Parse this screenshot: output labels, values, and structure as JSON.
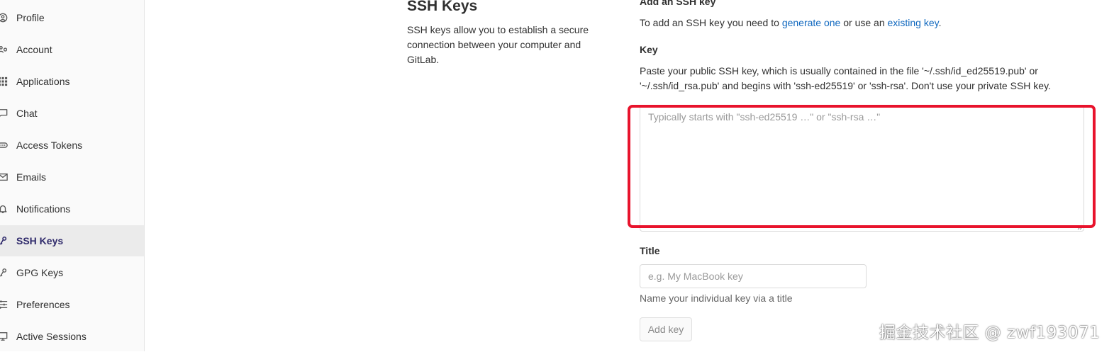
{
  "sidebar": {
    "items": [
      {
        "label": "Profile",
        "icon": "profile-icon"
      },
      {
        "label": "Account",
        "icon": "account-icon"
      },
      {
        "label": "Applications",
        "icon": "applications-icon"
      },
      {
        "label": "Chat",
        "icon": "chat-icon"
      },
      {
        "label": "Access Tokens",
        "icon": "token-icon"
      },
      {
        "label": "Emails",
        "icon": "mail-icon"
      },
      {
        "label": "Notifications",
        "icon": "bell-icon"
      },
      {
        "label": "SSH Keys",
        "icon": "key-icon",
        "active": true
      },
      {
        "label": "GPG Keys",
        "icon": "key-icon"
      },
      {
        "label": "Preferences",
        "icon": "preferences-icon"
      },
      {
        "label": "Active Sessions",
        "icon": "monitor-icon"
      }
    ]
  },
  "section": {
    "title": "SSH Keys",
    "description": "SSH keys allow you to establish a secure connection between your computer and GitLab."
  },
  "form": {
    "heading": "Add an SSH key",
    "intro_prefix": "To add an SSH key you need to ",
    "intro_link1": "generate one",
    "intro_middle": " or use an ",
    "intro_link2": "existing key",
    "intro_suffix": ".",
    "key_label": "Key",
    "key_help": "Paste your public SSH key, which is usually contained in the file '~/.ssh/id_ed25519.pub' or '~/.ssh/id_rsa.pub' and begins with 'ssh-ed25519' or 'ssh-rsa'. Don't use your private SSH key.",
    "key_placeholder": "Typically starts with \"ssh-ed25519 …\" or \"ssh-rsa …\"",
    "title_label": "Title",
    "title_placeholder": "e.g. My MacBook key",
    "title_help": "Name your individual key via a title",
    "add_button": "Add key"
  },
  "watermark": "掘金技术社区 @ zwf193071",
  "colors": {
    "link": "#1068bf",
    "highlight": "#e8132c",
    "active_nav": "#2f2a6b"
  }
}
